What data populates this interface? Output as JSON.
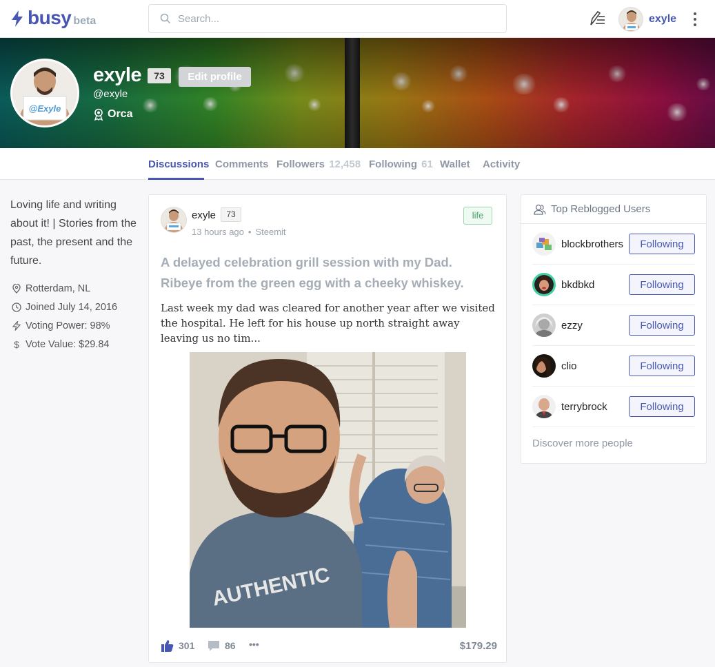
{
  "nav": {
    "logo": "busy",
    "beta": "beta",
    "search_placeholder": "Search...",
    "username": "exyle",
    "icons": [
      "bolt-icon",
      "search-icon",
      "write-icon",
      "kebab-menu-icon"
    ]
  },
  "profile": {
    "name": "exyle",
    "reputation": "73",
    "edit_label": "Edit profile",
    "handle": "@exyle",
    "rank": "Orca",
    "avatar_sign": "@Exyle"
  },
  "tabs": [
    {
      "label": "Discussions",
      "count": ""
    },
    {
      "label": "Comments",
      "count": ""
    },
    {
      "label": "Followers",
      "count": "12,458"
    },
    {
      "label": "Following",
      "count": "61"
    },
    {
      "label": "Wallet",
      "count": ""
    },
    {
      "label": "Activity",
      "count": ""
    }
  ],
  "sidebar": {
    "bio": "Loving life and writing about it! | Stories from the past, the present and the future.",
    "location": "Rotterdam, NL",
    "joined": "Joined July 14, 2016",
    "voting_power": "Voting Power: 98%",
    "vote_value": "Vote Value: $29.84"
  },
  "post": {
    "author": "exyle",
    "reputation": "73",
    "time": "13 hours ago",
    "source": "Steemit",
    "tag": "life",
    "title": "A delayed celebration grill session with my Dad. Ribeye from the green egg with a cheeky whiskey.",
    "excerpt": "Last week my dad was cleared for another year after we visited the hospital. He left for his house up north straight away leaving us no tim...",
    "likes": "301",
    "comments": "86",
    "more": "•••",
    "payout": "$179.29",
    "shirt_text": "AUTHENTIC"
  },
  "top_reblogged": {
    "title": "Top Reblogged Users",
    "users": [
      {
        "name": "blockbrothers",
        "button": "Following"
      },
      {
        "name": "bkdbkd",
        "button": "Following"
      },
      {
        "name": "ezzy",
        "button": "Following"
      },
      {
        "name": "clio",
        "button": "Following"
      },
      {
        "name": "terrybrock",
        "button": "Following"
      }
    ],
    "discover": "Discover more people"
  },
  "colors": {
    "brand": "#4757b2",
    "tag_green": "#48a36b",
    "muted": "#8f99a6"
  }
}
